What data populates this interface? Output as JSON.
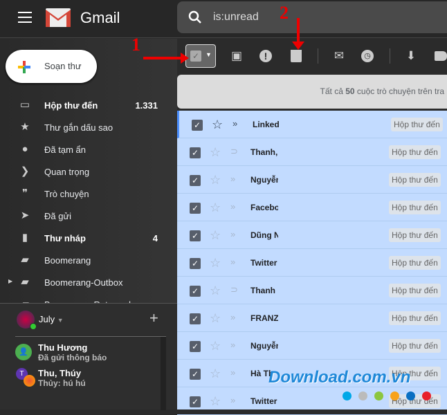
{
  "header": {
    "brand": "Gmail",
    "search_query": "is:unread"
  },
  "compose": {
    "label": "Soạn thư"
  },
  "sidebar": {
    "items": [
      {
        "label": "Hộp thư đến",
        "count": "1.331",
        "icon": "inbox-icon",
        "bold": true
      },
      {
        "label": "Thư gắn dấu sao",
        "count": "",
        "icon": "star-icon"
      },
      {
        "label": "Đã tạm ẩn",
        "count": "",
        "icon": "clock-icon"
      },
      {
        "label": "Quan trọng",
        "count": "",
        "icon": "important-icon"
      },
      {
        "label": "Trò chuyện",
        "count": "",
        "icon": "chat-icon"
      },
      {
        "label": "Đã gửi",
        "count": "",
        "icon": "send-icon"
      },
      {
        "label": "Thư nháp",
        "count": "4",
        "icon": "draft-icon",
        "bold": true
      },
      {
        "label": "Boomerang",
        "count": "",
        "icon": "label-icon"
      },
      {
        "label": "Boomerang-Outbox",
        "count": "",
        "icon": "label-icon"
      },
      {
        "label": "Boomerang-Returned",
        "count": "",
        "icon": "label-icon"
      }
    ]
  },
  "hangouts": {
    "user": "July",
    "chats": [
      {
        "name": "Thu Hương",
        "status": "Đã gửi thông báo"
      },
      {
        "name": "Thu, Thúy",
        "status": "Thủy: hú hú",
        "avatar_letter": "T"
      }
    ]
  },
  "info_bar": {
    "prefix": "Tất cả ",
    "count": "50",
    "suffix": " cuộc trò chuyện trên tra"
  },
  "emails": [
    {
      "sender": "Linked",
      "label": "Hộp thư đến"
    },
    {
      "sender": "Thanh,",
      "label": "Hộp thư đến"
    },
    {
      "sender": "Nguyễn",
      "label": "Hộp thư đến"
    },
    {
      "sender": "Facebo",
      "label": "Hộp thư đến"
    },
    {
      "sender": "Dũng N",
      "label": "Hộp thư đến"
    },
    {
      "sender": "Twitter",
      "label": "Hộp thư đến"
    },
    {
      "sender": "Thanh",
      "label": "Hộp thư đến"
    },
    {
      "sender": "FRANZ",
      "label": "Hộp thư đến"
    },
    {
      "sender": "Nguyễn",
      "label": "Hộp thư đến"
    },
    {
      "sender": "Hà Th",
      "label": "Hộp thư đến"
    },
    {
      "sender": "Twitter",
      "label": "Hộp thư đến"
    }
  ],
  "annotations": {
    "one": "1",
    "two": "2"
  },
  "watermark": {
    "text": "Download.com.vn",
    "dots": [
      "#00a8e8",
      "#bbbbbb",
      "#8cc63f",
      "#f7a21b",
      "#0a6fc2",
      "#e8202a"
    ]
  },
  "colors": {
    "selected_row": "#c2dbff",
    "accent": "#4d90fe",
    "annotation": "#e00000"
  }
}
